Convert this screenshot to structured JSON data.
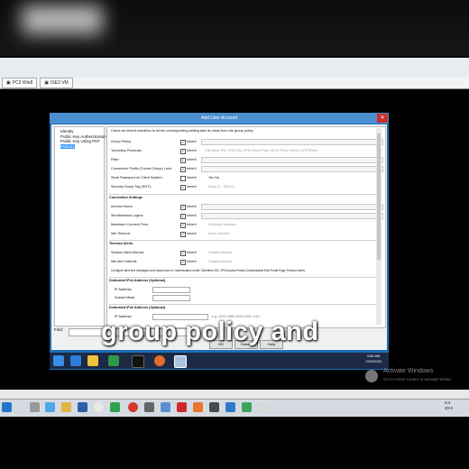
{
  "outer": {
    "tabs": [
      "PC2 Win8",
      "ISE3 VM"
    ]
  },
  "dialog": {
    "title": "Add User Account",
    "close_label": "✕",
    "tree": [
      "Identity",
      "Public Key Authentication",
      "Public Key Using PKF",
      "Policies"
    ],
    "intro": "Check an Inherit checkbox to let the corresponding setting take its value from the group policy.",
    "rows": [
      {
        "label": "Group Policy:",
        "extra": ""
      },
      {
        "label": "Tunneling Protocols:",
        "extra": "Clientless SSL VPN    SSL VPN Client    IPsec IKEv1    IPsec IKEv2    L2TP/IPsec"
      },
      {
        "label": "Filter:",
        "extra": ""
      },
      {
        "label": "Connection Profile (Tunnel Group) Lock:",
        "extra": ""
      },
      {
        "label": "Store Password on Client System:",
        "extra": "Yes    No"
      },
      {
        "label": "Security Group Tag (SGT):",
        "extra": "None    (2 - 65519)"
      }
    ],
    "conn_section": "Connection Settings",
    "conn_rows": [
      {
        "label": "Access Hours:",
        "extra": ""
      },
      {
        "label": "Simultaneous Logins:",
        "extra": ""
      },
      {
        "label": "Maximum Connect Time:",
        "extra": "Unlimited    minutes"
      },
      {
        "label": "Idle Timeout:",
        "extra": "None    minutes"
      }
    ],
    "timeout_section": "Timeout Alerts",
    "timeout_rows": [
      {
        "label": "Session Alert Interval:",
        "extra": "Default    minutes"
      },
      {
        "label": "Idle Alert Interval:",
        "extra": "Default    minutes"
      }
    ],
    "timeout_note": "Configure alert text messages and visual cues in Customization under Clientless SSL VPN Access-Portal-Customization-Edit-Portal Page-Timeout Alerts.",
    "ipv4_section": "Dedicated IPv4 Address (Optional)",
    "ipv4_rows": [
      "IP Address:",
      "Subnet Mask:"
    ],
    "ipv6_section": "Dedicated IPv6 Address (Optional)",
    "ipv6_row": "IP Address:",
    "ipv6_hint": "e.g. 2001:DB8:2000:1200::1/64",
    "inherit_label": "Inherit",
    "find_label": "Find:",
    "buttons": [
      "OK",
      "Cancel",
      "Help"
    ]
  },
  "inner_clock": [
    "3:56 AM",
    "7/20/2020"
  ],
  "caption": "group policy and",
  "activate": {
    "title": "Activate Windows",
    "sub": "Go to Action Center to activate Windo"
  },
  "host_clock": [
    "3:4",
    "20-0"
  ],
  "colors": {
    "dialog_title": "#4c8fd0",
    "taskbar": "#1c2a45",
    "selection": "#3399ff"
  }
}
